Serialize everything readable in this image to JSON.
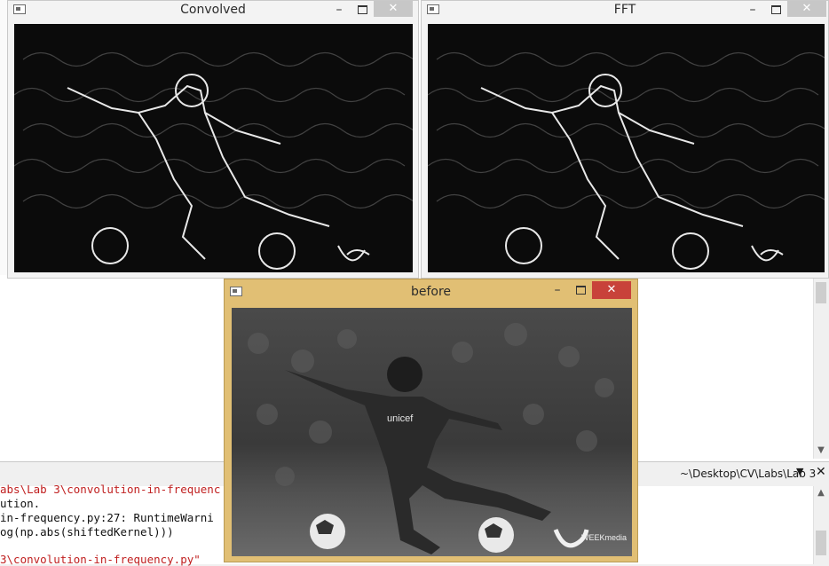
{
  "windows": {
    "convolved": {
      "title": "Convolved",
      "minimize": "–",
      "close": "✕"
    },
    "fft": {
      "title": "FFT",
      "minimize": "–",
      "close": "✕"
    },
    "before": {
      "title": "before",
      "minimize": "–",
      "close": "✕"
    }
  },
  "image": {
    "shirt_text": "unicef",
    "logo_text": "WEEKmedia"
  },
  "console": {
    "path_label": "~\\Desktop\\CV\\Labs\\Lab 3",
    "lines": [
      "abs\\Lab 3\\convolution-in-frequenc",
      "ution.",
      "in-frequency.py:27: RuntimeWarni",
      "og(np.abs(shiftedKernel)))",
      "",
      "3\\convolution-in-frequency.py\""
    ]
  },
  "colors": {
    "active_frame": "#e1bf74",
    "close_active": "#c8423a",
    "console_red": "#c02020"
  }
}
